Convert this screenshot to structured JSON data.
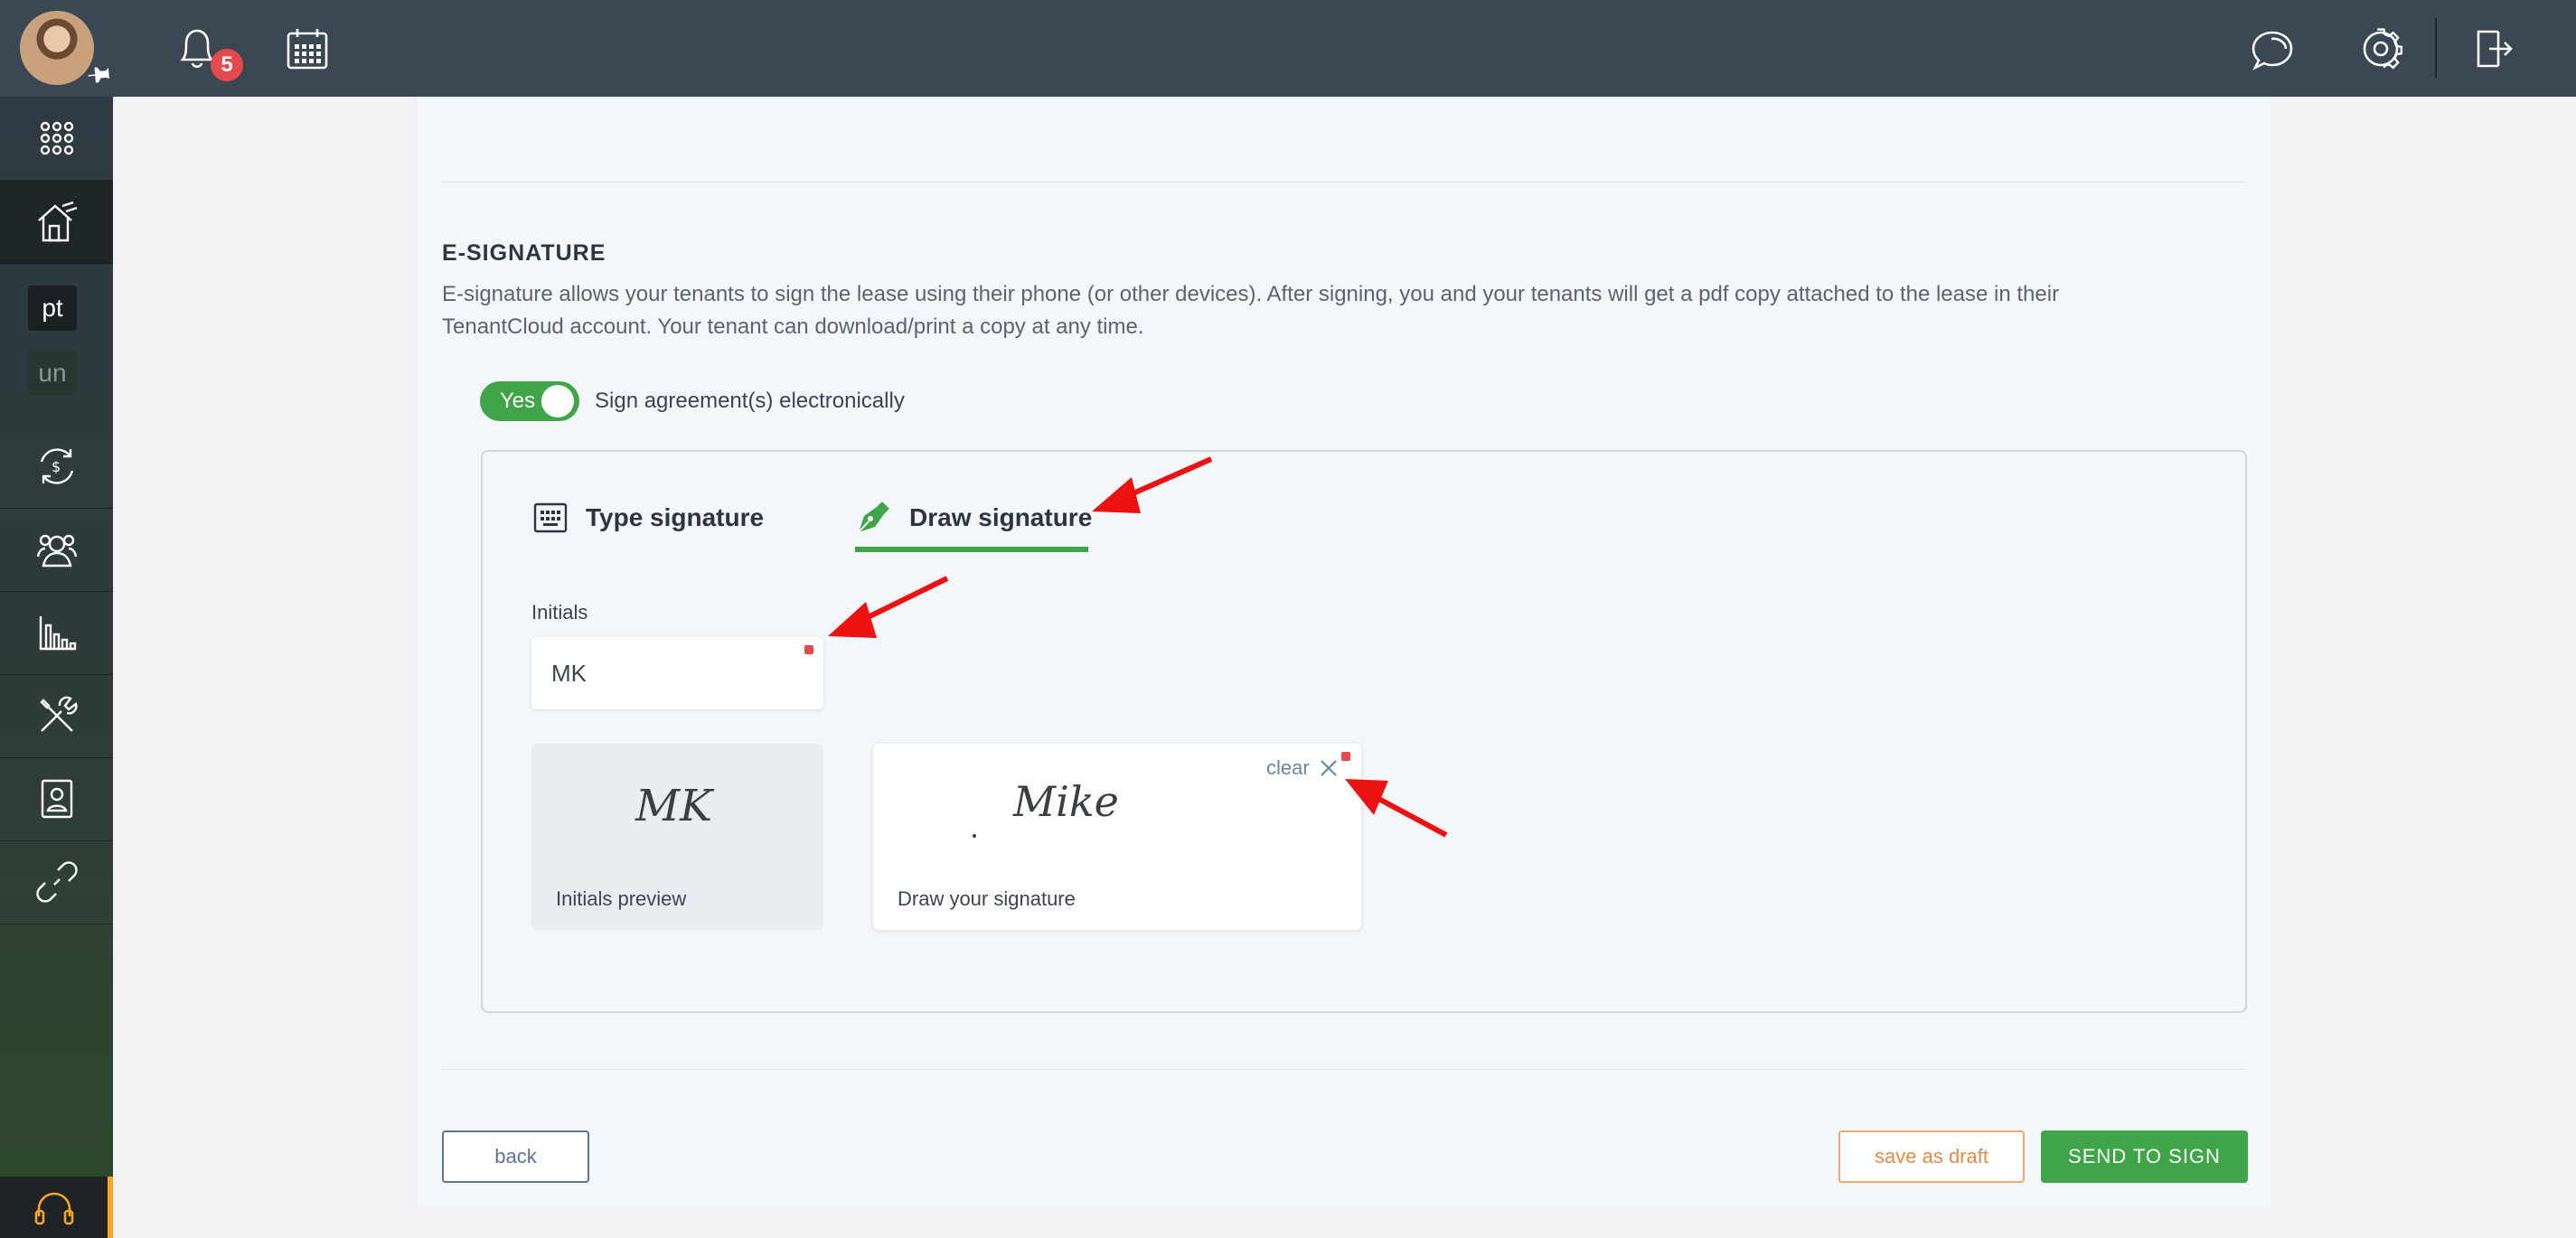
{
  "header": {
    "notification_count": "5",
    "icons": [
      "avatar",
      "pin-icon",
      "bell-icon",
      "calendar-icon",
      "chat-icon",
      "gear-icon",
      "logout-icon"
    ]
  },
  "sidebar": {
    "items": [
      {
        "icon": "apps-grid-icon"
      },
      {
        "icon": "house-icon",
        "active": true
      },
      {
        "label": "pt"
      },
      {
        "label": "un"
      },
      {
        "icon": "money-exchange-icon"
      },
      {
        "icon": "people-icon"
      },
      {
        "icon": "bar-chart-icon"
      },
      {
        "icon": "tools-icon"
      },
      {
        "icon": "document-user-icon"
      },
      {
        "icon": "link-icon"
      },
      {
        "icon": "headset-icon"
      }
    ]
  },
  "esignature": {
    "title": "E-SIGNATURE",
    "description": "E-signature allows your tenants to sign the lease using their phone (or other devices). After signing, you and your tenants will get a pdf copy attached to the lease in their TenantCloud account. Your tenant can download/print a copy at any time.",
    "toggle_value": "Yes",
    "toggle_text": "Sign agreement(s) electronically",
    "tabs": [
      {
        "label": "Type signature",
        "icon": "keyboard-icon",
        "active": false
      },
      {
        "label": "Draw signature",
        "icon": "pen-nib-icon",
        "active": true
      }
    ],
    "initials_label": "Initials",
    "initials_value": "MK",
    "initials_preview_text": "MK",
    "initials_preview_label": "Initials preview",
    "drawn_signature_text": "Mike",
    "draw_label": "Draw your signature",
    "clear_label": "clear"
  },
  "actions": {
    "back": "back",
    "save_draft": "save as draft",
    "send": "SEND TO SIGN"
  },
  "colors": {
    "topbar": "#3b4753",
    "accent_green": "#3fa548",
    "draft_orange": "#e58a46",
    "badge_red": "#e5484d",
    "annotation_red": "#ee1111"
  }
}
